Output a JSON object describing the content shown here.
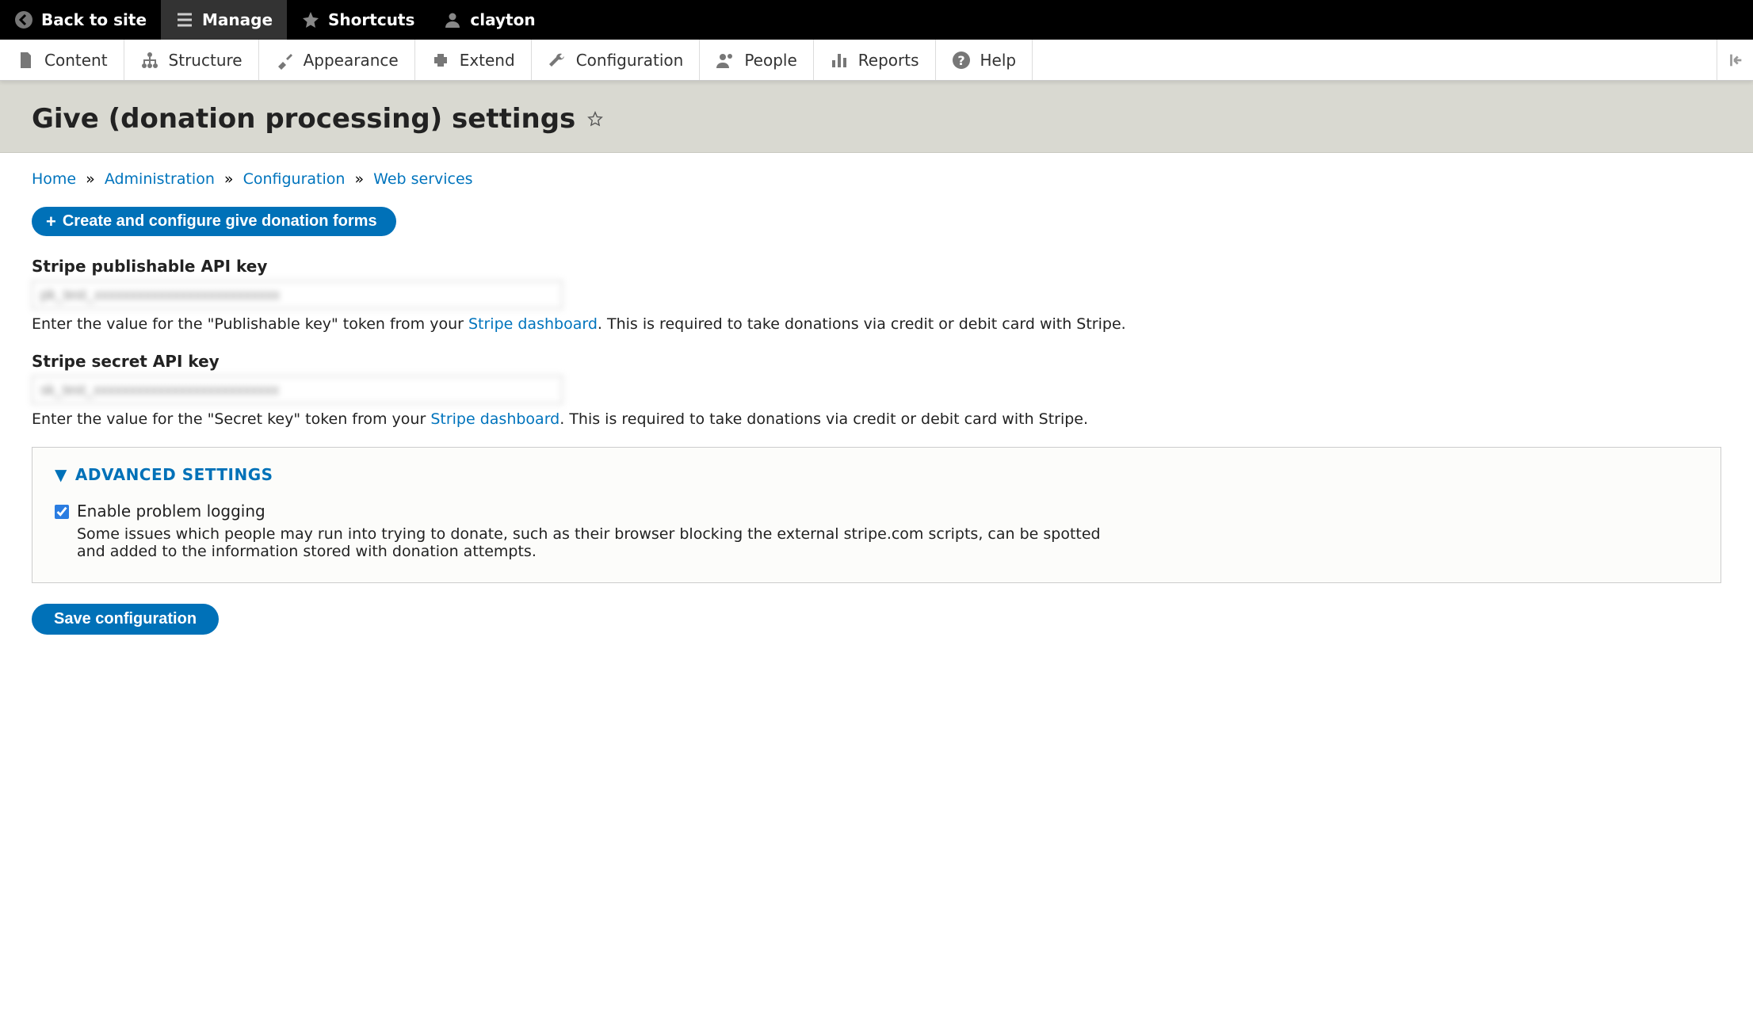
{
  "toolbar": {
    "back": "Back to site",
    "manage": "Manage",
    "shortcuts": "Shortcuts",
    "user": "clayton"
  },
  "adminbar": {
    "items": [
      {
        "label": "Content"
      },
      {
        "label": "Structure"
      },
      {
        "label": "Appearance"
      },
      {
        "label": "Extend"
      },
      {
        "label": "Configuration"
      },
      {
        "label": "People"
      },
      {
        "label": "Reports"
      },
      {
        "label": "Help"
      }
    ]
  },
  "page": {
    "title": "Give (donation processing) settings"
  },
  "breadcrumb": {
    "items": [
      {
        "label": "Home"
      },
      {
        "label": "Administration"
      },
      {
        "label": "Configuration"
      },
      {
        "label": "Web services"
      }
    ],
    "sep": "»"
  },
  "actions": {
    "create_forms": "Create and configure give donation forms"
  },
  "fields": {
    "pubkey": {
      "label": "Stripe publishable API key",
      "value": "pk_test_xxxxxxxxxxxxxxxxxxxxxxxxxx",
      "desc_pre": "Enter the value for the \"Publishable key\" token from your ",
      "desc_link": "Stripe dashboard",
      "desc_post": ". This is required to take donations via credit or debit card with Stripe."
    },
    "secret": {
      "label": "Stripe secret API key",
      "value": "sk_test_xxxxxxxxxxxxxxxxxxxxxxxxxx",
      "desc_pre": "Enter the value for the \"Secret key\" token from your ",
      "desc_link": "Stripe dashboard",
      "desc_post": ". This is required to take donations via credit or debit card with Stripe."
    }
  },
  "advanced": {
    "title": "ADVANCED SETTINGS",
    "logging": {
      "label": "Enable problem logging",
      "desc": "Some issues which people may run into trying to donate, such as their browser blocking the external stripe.com scripts, can be spotted and added to the information stored with donation attempts."
    }
  },
  "buttons": {
    "save": "Save configuration"
  }
}
